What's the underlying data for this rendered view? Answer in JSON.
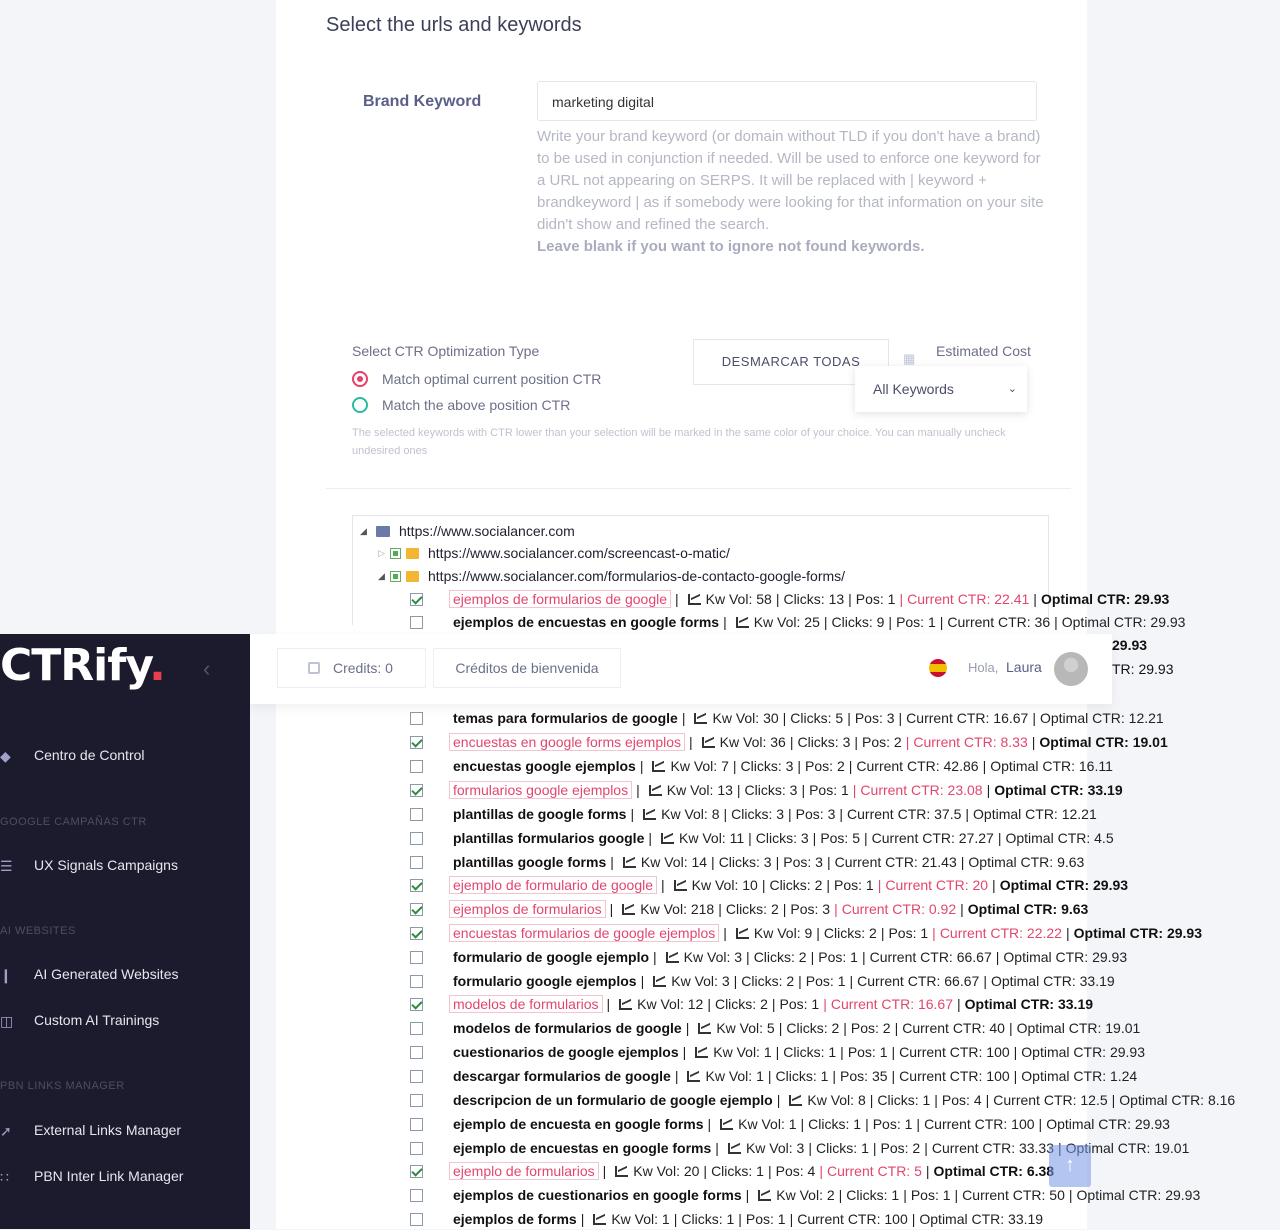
{
  "page_title": "Select the urls and keywords",
  "brand": {
    "label": "Brand Keyword",
    "value": "marketing digital",
    "help": "Write your brand keyword (or domain without TLD if you don't have a brand) to be used in conjunction if needed. Will be used to enforce one keyword for a URL not appearing on SERPS. It will be replaced with | keyword + brandkeyword | as if somebody were looking for that information on your site didn't show and refined the search.",
    "help_bold": "Leave blank if you want to ignore not found keywords."
  },
  "ctr": {
    "title": "Select CTR Optimization Type",
    "option1": "Match optimal current position CTR",
    "option2": "Match the above position CTR",
    "note": "The selected keywords with CTR lower than your selection will be marked in the same color of your choice. You can manually uncheck undesired ones",
    "desmarcar": "DESMARCAR TODAS",
    "estimated_cost": "Estimated Cost",
    "filter_value": "All Keywords",
    "accent_selected": "#e83e6c",
    "accent_other": "#2bb8a0"
  },
  "tree": {
    "root": "https://www.socialancer.com",
    "child1": "https://www.socialancer.com/screencast-o-matic/",
    "child2": "https://www.socialancer.com/formularios-de-contacto-google-forms/"
  },
  "keywords": [
    {
      "checked": true,
      "name": "ejemplos de formularios de google",
      "kwvol": "Kw Vol: 58",
      "clicks": "Clicks: 13",
      "pos": "Pos: 1",
      "current": "Current CTR: 22.41",
      "optimal": "Optimal CTR: 29.93"
    },
    {
      "checked": false,
      "name": "ejemplos de encuestas en google forms",
      "kwvol": "Kw Vol: 25",
      "clicks": "Clicks: 9",
      "pos": "Pos: 1",
      "current": "Current CTR: 36",
      "optimal": "Optimal CTR: 29.93"
    },
    {
      "checked": false,
      "name": "temas para formularios de google",
      "kwvol": "Kw Vol: 30",
      "clicks": "Clicks: 5",
      "pos": "Pos: 3",
      "current": "Current CTR: 16.67",
      "optimal": "Optimal CTR: 12.21"
    },
    {
      "checked": true,
      "name": "encuestas en google forms ejemplos",
      "kwvol": "Kw Vol: 36",
      "clicks": "Clicks: 3",
      "pos": "Pos: 2",
      "current": "Current CTR: 8.33",
      "optimal": "Optimal CTR: 19.01"
    },
    {
      "checked": false,
      "name": "encuestas google ejemplos",
      "kwvol": "Kw Vol: 7",
      "clicks": "Clicks: 3",
      "pos": "Pos: 2",
      "current": "Current CTR: 42.86",
      "optimal": "Optimal CTR: 16.11"
    },
    {
      "checked": true,
      "name": "formularios google ejemplos",
      "kwvol": "Kw Vol: 13",
      "clicks": "Clicks: 3",
      "pos": "Pos: 1",
      "current": "Current CTR: 23.08",
      "optimal": "Optimal CTR: 33.19"
    },
    {
      "checked": false,
      "name": "plantillas de google forms",
      "kwvol": "Kw Vol: 8",
      "clicks": "Clicks: 3",
      "pos": "Pos: 3",
      "current": "Current CTR: 37.5",
      "optimal": "Optimal CTR: 12.21"
    },
    {
      "checked": false,
      "name": "plantillas formularios google",
      "kwvol": "Kw Vol: 11",
      "clicks": "Clicks: 3",
      "pos": "Pos: 5",
      "current": "Current CTR: 27.27",
      "optimal": "Optimal CTR: 4.5"
    },
    {
      "checked": false,
      "name": "plantillas google forms",
      "kwvol": "Kw Vol: 14",
      "clicks": "Clicks: 3",
      "pos": "Pos: 3",
      "current": "Current CTR: 21.43",
      "optimal": "Optimal CTR: 9.63"
    },
    {
      "checked": true,
      "name": "ejemplo de formulario de google",
      "kwvol": "Kw Vol: 10",
      "clicks": "Clicks: 2",
      "pos": "Pos: 1",
      "current": "Current CTR: 20",
      "optimal": "Optimal CTR: 29.93"
    },
    {
      "checked": true,
      "name": "ejemplos de formularios",
      "kwvol": "Kw Vol: 218",
      "clicks": "Clicks: 2",
      "pos": "Pos: 3",
      "current": "Current CTR: 0.92",
      "optimal": "Optimal CTR: 9.63"
    },
    {
      "checked": true,
      "name": "encuestas formularios de google ejemplos",
      "kwvol": "Kw Vol: 9",
      "clicks": "Clicks: 2",
      "pos": "Pos: 1",
      "current": "Current CTR: 22.22",
      "optimal": "Optimal CTR: 29.93"
    },
    {
      "checked": false,
      "name": "formulario de google ejemplo",
      "kwvol": "Kw Vol: 3",
      "clicks": "Clicks: 2",
      "pos": "Pos: 1",
      "current": "Current CTR: 66.67",
      "optimal": "Optimal CTR: 29.93"
    },
    {
      "checked": false,
      "name": "formulario google ejemplos",
      "kwvol": "Kw Vol: 3",
      "clicks": "Clicks: 2",
      "pos": "Pos: 1",
      "current": "Current CTR: 66.67",
      "optimal": "Optimal CTR: 33.19"
    },
    {
      "checked": true,
      "name": "modelos de formularios",
      "kwvol": "Kw Vol: 12",
      "clicks": "Clicks: 2",
      "pos": "Pos: 1",
      "current": "Current CTR: 16.67",
      "optimal": "Optimal CTR: 33.19"
    },
    {
      "checked": false,
      "name": "modelos de formularios de google",
      "kwvol": "Kw Vol: 5",
      "clicks": "Clicks: 2",
      "pos": "Pos: 2",
      "current": "Current CTR: 40",
      "optimal": "Optimal CTR: 19.01"
    },
    {
      "checked": false,
      "name": "cuestionarios de google ejemplos",
      "kwvol": "Kw Vol: 1",
      "clicks": "Clicks: 1",
      "pos": "Pos: 1",
      "current": "Current CTR: 100",
      "optimal": "Optimal CTR: 29.93"
    },
    {
      "checked": false,
      "name": "descargar formularios de google",
      "kwvol": "Kw Vol: 1",
      "clicks": "Clicks: 1",
      "pos": "Pos: 35",
      "current": "Current CTR: 100",
      "optimal": "Optimal CTR: 1.24"
    },
    {
      "checked": false,
      "name": "descripcion de un formulario de google ejemplo",
      "kwvol": "Kw Vol: 8",
      "clicks": "Clicks: 1",
      "pos": "Pos: 4",
      "current": "Current CTR: 12.5",
      "optimal": "Optimal CTR: 8.16"
    },
    {
      "checked": false,
      "name": "ejemplo de encuesta en google forms",
      "kwvol": "Kw Vol: 1",
      "clicks": "Clicks: 1",
      "pos": "Pos: 1",
      "current": "Current CTR: 100",
      "optimal": "Optimal CTR: 29.93"
    },
    {
      "checked": false,
      "name": "ejemplo de encuestas en google forms",
      "kwvol": "Kw Vol: 3",
      "clicks": "Clicks: 1",
      "pos": "Pos: 2",
      "current": "Current CTR: 33.33",
      "optimal": "Optimal CTR: 19.01"
    },
    {
      "checked": true,
      "name": "ejemplo de formularios",
      "kwvol": "Kw Vol: 20",
      "clicks": "Clicks: 1",
      "pos": "Pos: 4",
      "current": "Current CTR: 5",
      "optimal": "Optimal CTR: 6.38"
    },
    {
      "checked": false,
      "name": "ejemplos de cuestionarios en google forms",
      "kwvol": "Kw Vol: 2",
      "clicks": "Clicks: 1",
      "pos": "Pos: 1",
      "current": "Current CTR: 50",
      "optimal": "Optimal CTR: 29.93"
    },
    {
      "checked": false,
      "name": "ejemplos de forms",
      "kwvol": "Kw Vol: 1",
      "clicks": "Clicks: 1",
      "pos": "Pos: 1",
      "current": "Current CTR: 100",
      "optimal": "Optimal CTR: 33.19"
    }
  ],
  "peek": {
    "line1": "29.93",
    "line2": "TR: 29.93"
  },
  "header": {
    "credits": "Credits: 0",
    "welcome": "Créditos de bienvenida",
    "hola": "Hola,",
    "user": "Laura"
  },
  "sidebar": {
    "logo_main": "CTRify",
    "logo_dot": ".",
    "centro": "Centro de Control",
    "sec_google": "GOOGLE CAMPAÑAS CTR",
    "ux": "UX Signals Campaigns",
    "sec_ai": "AI WEBSITES",
    "ai_gen": "AI Generated Websites",
    "custom_ai": "Custom AI Trainings",
    "sec_pbn": "PBN LINKS MANAGER",
    "ext_links": "External Links Manager",
    "pbn_inter": "PBN Inter Link Manager"
  }
}
